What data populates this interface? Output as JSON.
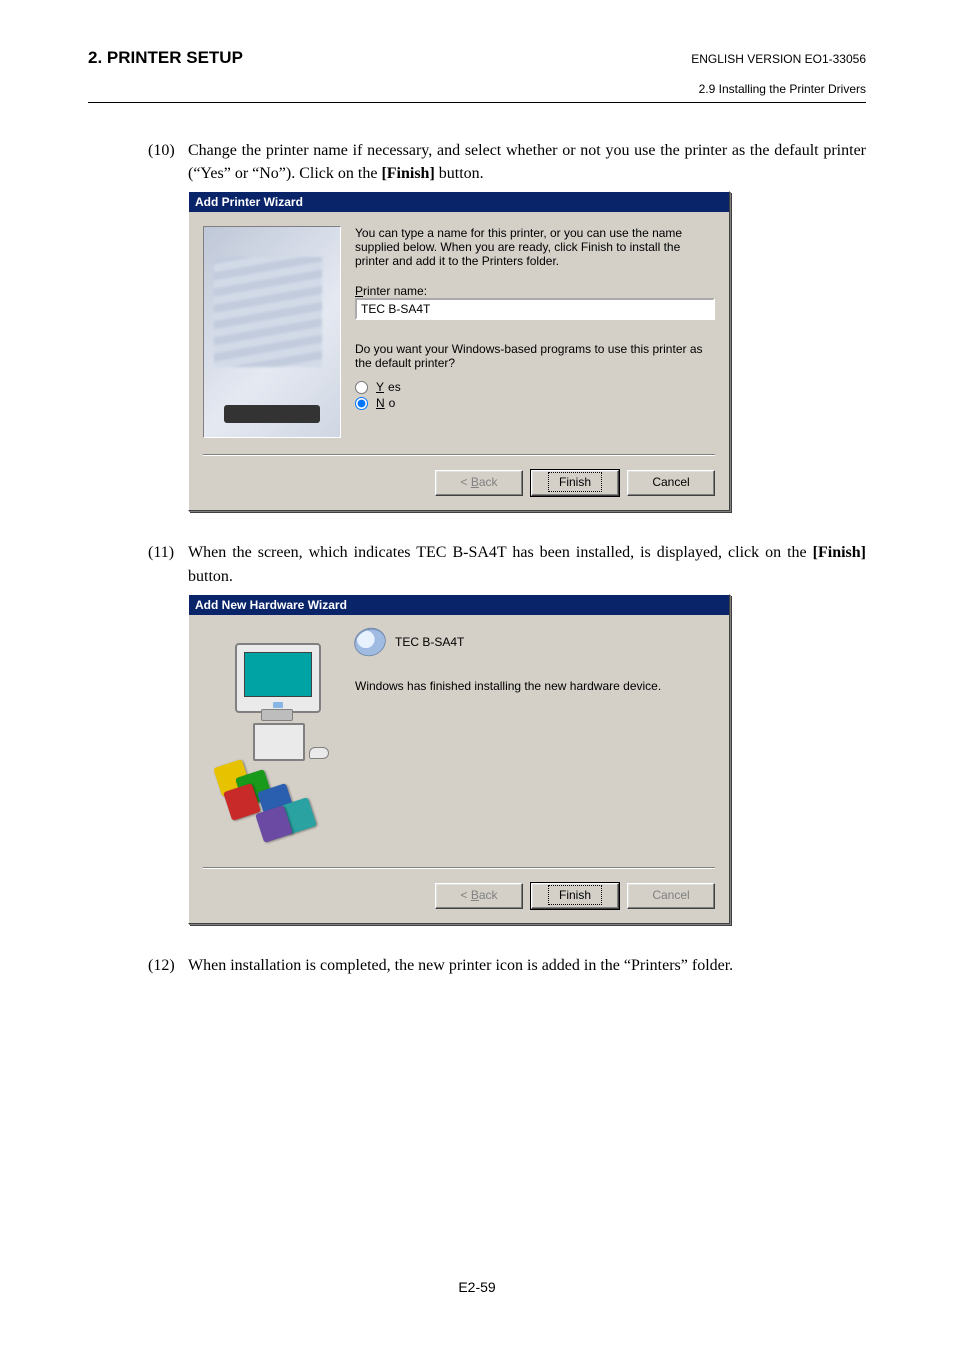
{
  "header": {
    "section_title": "2. PRINTER SETUP",
    "version_line": "ENGLISH VERSION EO1-33056",
    "subsection": "2.9 Installing the Printer Drivers"
  },
  "step10": {
    "num": "(10)",
    "text": "Change the printer name if necessary, and select whether or not you use the printer as the default printer (“Yes” or “No”).  Click on the ",
    "bold": "[Finish]",
    "after_bold": " button."
  },
  "dialog1": {
    "title": "Add Printer Wizard",
    "intro": "You can type a name for this printer, or you can use the name supplied below. When you are ready, click Finish to install the printer and add it to the Printers folder.",
    "label_prefix": "P",
    "label_rest": "rinter name:",
    "value": "TEC B-SA4T",
    "question": "Do you want your Windows-based programs to use this printer as the default printer?",
    "yes_u": "Y",
    "yes_rest": "es",
    "no_u": "N",
    "no_rest": "o",
    "radio_selected": "no",
    "back_lt": "< ",
    "back_u": "B",
    "back_rest": "ack",
    "finish": "Finish",
    "cancel": "Cancel"
  },
  "step11": {
    "num": "(11)",
    "text_before": "When the screen, which indicates TEC B-SA4T has been installed, is displayed, click on the ",
    "bold": "[Finish]",
    "after_bold": " button."
  },
  "dialog2": {
    "title": "Add New Hardware Wizard",
    "device": "TEC B-SA4T",
    "done": "Windows has finished installing the new hardware device.",
    "back_lt": "< ",
    "back_u": "B",
    "back_rest": "ack",
    "finish": "Finish",
    "cancel": "Cancel"
  },
  "step12": {
    "num": "(12)",
    "text": "When installation is completed, the new printer icon is added in the “Printers” folder."
  },
  "page_number": "E2-59"
}
